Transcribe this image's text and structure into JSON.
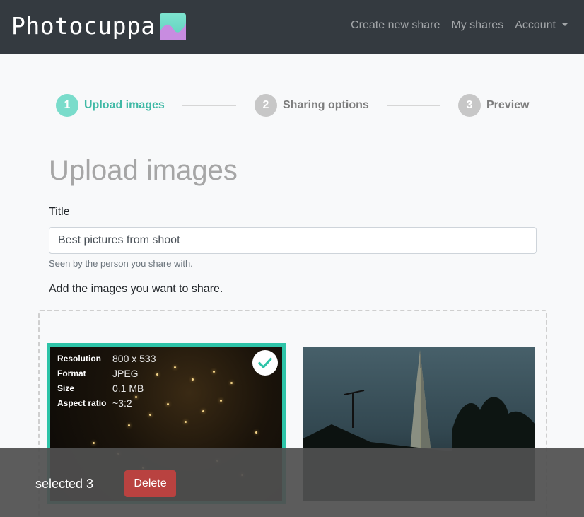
{
  "app": {
    "brand": "Photocuppa",
    "logo_icon": "photocuppa-logo-icon"
  },
  "nav": {
    "create": "Create new share",
    "shares": "My shares",
    "account": "Account"
  },
  "steps": [
    {
      "number": "1",
      "label": "Upload images",
      "state": "active"
    },
    {
      "number": "2",
      "label": "Sharing options",
      "state": "inactive"
    },
    {
      "number": "3",
      "label": "Preview",
      "state": "inactive"
    }
  ],
  "page": {
    "heading": "Upload images",
    "title_label": "Title",
    "title_value": "Best pictures from shoot",
    "title_help": "Seen by the person you share with.",
    "add_images_text": "Add the images you want to share."
  },
  "images": [
    {
      "selected": true,
      "meta": [
        {
          "key": "Resolution",
          "value": "800 x 533"
        },
        {
          "key": "Format",
          "value": "JPEG"
        },
        {
          "key": "Size",
          "value": "0.1 MB"
        },
        {
          "key": "Aspect ratio",
          "value": "~3:2"
        }
      ]
    },
    {
      "selected": false
    }
  ],
  "selection_bar": {
    "text": "selected 3",
    "delete_label": "Delete"
  },
  "colors": {
    "navbar": "#343a40",
    "accent": "#2ec4a8",
    "delete": "#b94240"
  }
}
